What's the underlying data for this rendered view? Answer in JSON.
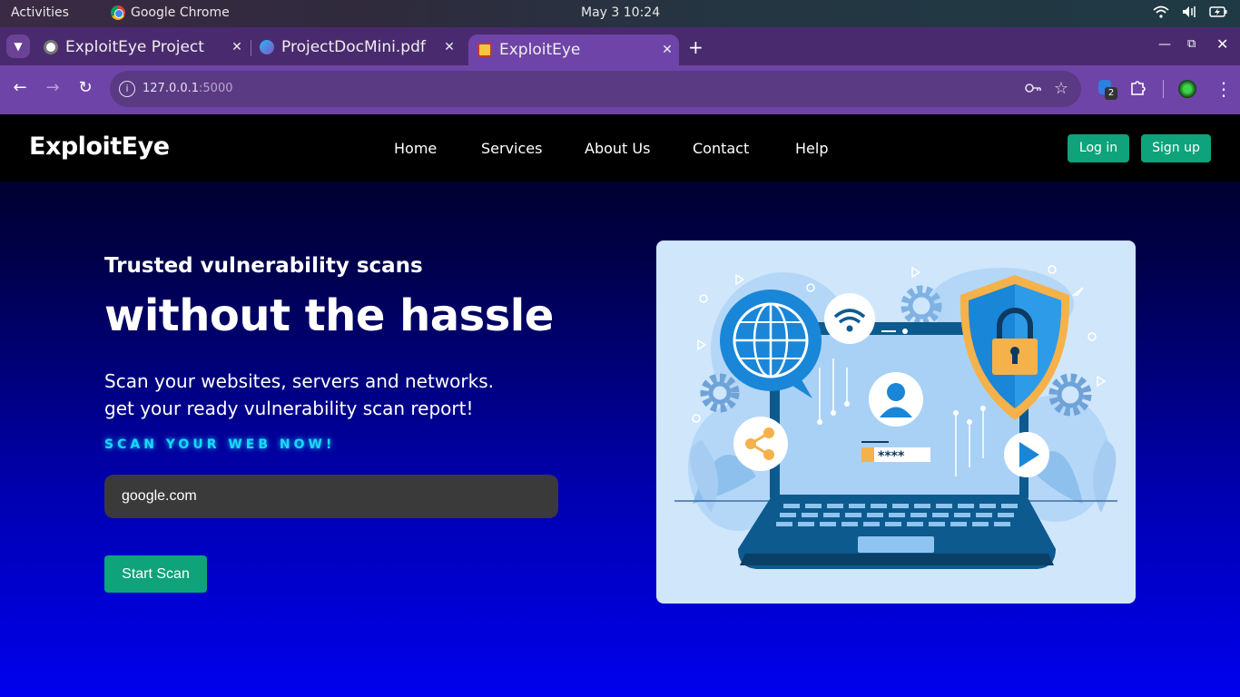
{
  "os_bar": {
    "activities": "Activities",
    "app_name": "Google Chrome",
    "clock": "May 3  10:24"
  },
  "browser": {
    "tabs": [
      {
        "title": "ExploitEye Project",
        "active": false
      },
      {
        "title": "ProjectDocMini.pdf",
        "active": false
      },
      {
        "title": "ExploitEye",
        "active": true
      }
    ],
    "url_host": "127.0.0.1",
    "url_port": ":5000",
    "extension_badge": "2"
  },
  "site": {
    "logo": "ExploitEye",
    "nav": [
      "Home",
      "Services",
      "About Us",
      "Contact",
      "Help"
    ],
    "login_label": "Log in",
    "signup_label": "Sign up",
    "hero": {
      "subtitle": "Trusted vulnerability scans",
      "title": "without the hassle",
      "desc_line1": "Scan your websites, servers and networks.",
      "desc_line2": "get your ready vulnerability scan report!",
      "cta": "SCAN YOUR WEB NOW!",
      "input_value": "google.com",
      "button_label": "Start Scan"
    },
    "illustration": {
      "password_mask": "****"
    }
  },
  "colors": {
    "accent_green": "#0ea37a",
    "cta_cyan": "#19d8ff",
    "browser_purple": "#6f44a8"
  }
}
